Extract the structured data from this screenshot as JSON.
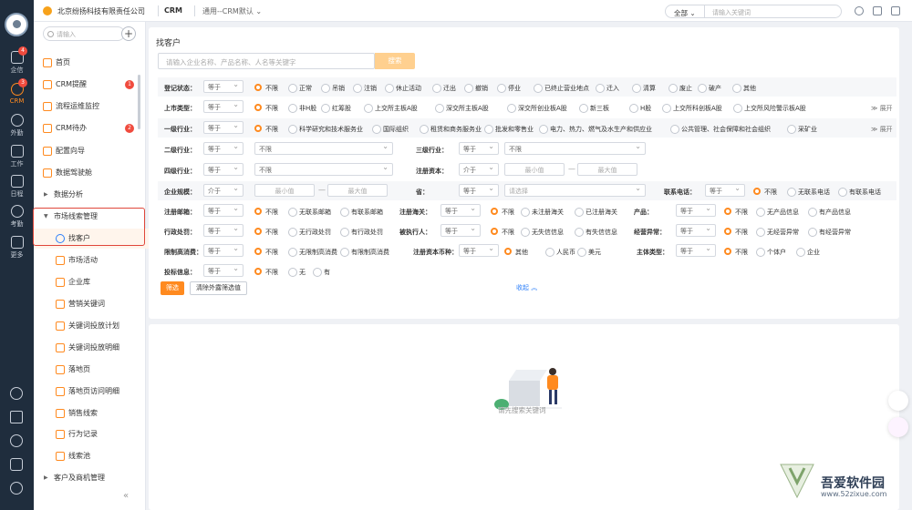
{
  "rail": {
    "items": [
      {
        "label": "企信",
        "badge": "4"
      },
      {
        "label": "CRM",
        "badge": "3"
      },
      {
        "label": "外勤",
        "badge": ""
      },
      {
        "label": "工作",
        "badge": ""
      },
      {
        "label": "日程",
        "badge": ""
      },
      {
        "label": "考勤",
        "badge": ""
      },
      {
        "label": "更多",
        "badge": ""
      }
    ],
    "bottom_icons": [
      "help-icon",
      "notice-icon",
      "history-icon",
      "contacts-icon",
      "settings-icon"
    ]
  },
  "topbar": {
    "company": "北京纷扬科技有限责任公司",
    "app": "CRM",
    "template": "通用--CRM默认",
    "scope": "全部",
    "search_placeholder": "请输入关键词"
  },
  "sidebar": {
    "search_placeholder": "请输入",
    "items": [
      {
        "label": "首页",
        "badge": "",
        "type": "top"
      },
      {
        "label": "CRM提醒",
        "badge": "1",
        "type": "top"
      },
      {
        "label": "流程运维监控",
        "badge": "",
        "type": "top"
      },
      {
        "label": "CRM待办",
        "badge": "2",
        "type": "top"
      },
      {
        "label": "配置向导",
        "badge": "",
        "type": "top"
      },
      {
        "label": "数据驾驶舱",
        "badge": "",
        "type": "top"
      },
      {
        "label": "数据分析",
        "badge": "",
        "type": "group"
      },
      {
        "label": "市场线索管理",
        "badge": "",
        "type": "group"
      },
      {
        "label": "找客户",
        "badge": "",
        "type": "sub"
      },
      {
        "label": "市场活动",
        "badge": "",
        "type": "sub"
      },
      {
        "label": "企业库",
        "badge": "",
        "type": "sub"
      },
      {
        "label": "营销关键词",
        "badge": "",
        "type": "sub"
      },
      {
        "label": "关键词投放计划",
        "badge": "",
        "type": "sub"
      },
      {
        "label": "关键词投放明细",
        "badge": "",
        "type": "sub"
      },
      {
        "label": "落地页",
        "badge": "",
        "type": "sub"
      },
      {
        "label": "落地页访问明细",
        "badge": "",
        "type": "sub"
      },
      {
        "label": "销售线索",
        "badge": "",
        "type": "sub"
      },
      {
        "label": "行为记录",
        "badge": "",
        "type": "sub"
      },
      {
        "label": "线索池",
        "badge": "",
        "type": "sub"
      },
      {
        "label": "客户及商机管理",
        "badge": "",
        "type": "group"
      }
    ],
    "collapse": "«"
  },
  "page": {
    "title": "找客户",
    "search_placeholder": "请输入企业名称、产品名称、人名等关键字",
    "search_button": "搜索",
    "filters": {
      "reg_status": {
        "label": "登记状态：",
        "op": "等于",
        "options": [
          "不限",
          "正常",
          "吊销",
          "注销",
          "休止活动",
          "迁出",
          "撤销",
          "停业",
          "已终止营业地点",
          "迁入",
          "清算",
          "废止",
          "破产",
          "其他"
        ]
      },
      "listing": {
        "label": "上市类型：",
        "op": "等于",
        "options": [
          "不限",
          "非H股",
          "红筹股",
          "上交所主板A股",
          "深交所主板A股",
          "深交所创业板A股",
          "新三板",
          "H股",
          "上交所科创板A股",
          "上交所风险警示板A股"
        ],
        "expand": "展开"
      },
      "industry1": {
        "label": "一级行业：",
        "op": "等于",
        "options": [
          "不限",
          "科学研究和技术服务业",
          "国际组织",
          "租赁和商务服务业",
          "批发和零售业",
          "电力、热力、燃气及水生产和供应业",
          "公共管理、社会保障和社会组织",
          "采矿业"
        ],
        "expand": "展开"
      },
      "industry2": {
        "label": "二级行业：",
        "op": "等于",
        "value": "不限"
      },
      "industry3": {
        "label": "三级行业：",
        "op": "等于",
        "value": "不限"
      },
      "industry4": {
        "label": "四级行业：",
        "op": "等于",
        "value": "不限"
      },
      "capital": {
        "label": "注册资本：",
        "op": "介于",
        "min": "最小值",
        "max": "最大值"
      },
      "scale": {
        "label": "企业规模：",
        "op": "介于",
        "min": "最小值",
        "max": "最大值"
      },
      "province": {
        "label": "省：",
        "op": "等于",
        "placeholder": "请选择"
      },
      "phone": {
        "label": "联系电话：",
        "op": "等于",
        "options": [
          "不限",
          "无联系电话",
          "有联系电话"
        ]
      },
      "email": {
        "label": "注册邮箱：",
        "op": "等于",
        "options": [
          "不限",
          "无联系邮箱",
          "有联系邮箱"
        ]
      },
      "customs": {
        "label": "注册海关：",
        "op": "等于",
        "options": [
          "不限",
          "未注册海关",
          "已注册海关"
        ]
      },
      "product": {
        "label": "产品：",
        "op": "等于",
        "options": [
          "不限",
          "无产品信息",
          "有产品信息"
        ]
      },
      "penalty": {
        "label": "行政处罚：",
        "op": "等于",
        "options": [
          "不限",
          "无行政处罚",
          "有行政处罚"
        ]
      },
      "executed": {
        "label": "被执行人：",
        "op": "等于",
        "options": [
          "不限",
          "无失信信息",
          "有失信信息"
        ]
      },
      "abnormal": {
        "label": "经营异常：",
        "op": "等于",
        "options": [
          "不限",
          "无经营异常",
          "有经营异常"
        ]
      },
      "high_consume": {
        "label": "限制高消费：",
        "op": "等于",
        "options": [
          "不限",
          "无限制高消费",
          "有限制高消费"
        ]
      },
      "currency": {
        "label": "注册资本币种：",
        "op": "等于",
        "options": [
          "其他",
          "人民币",
          "美元"
        ]
      },
      "subject": {
        "label": "主体类型：",
        "op": "等于",
        "options": [
          "不限",
          "个体户",
          "企业"
        ]
      },
      "bid": {
        "label": "投标信息：",
        "op": "等于",
        "options": [
          "不限",
          "无",
          "有"
        ]
      }
    },
    "filter_button": "筛选",
    "clear_button": "清除外露筛选值",
    "collapse_link": "收起",
    "empty_text": "请先搜索关键词"
  },
  "watermark": {
    "name": "吾爱软件园",
    "url": "www.52zixue.com"
  },
  "colors": {
    "accent": "#ff8a1f",
    "link": "#2d7ff9",
    "rail": "#1f2d3d",
    "badge": "#f04b3e"
  }
}
